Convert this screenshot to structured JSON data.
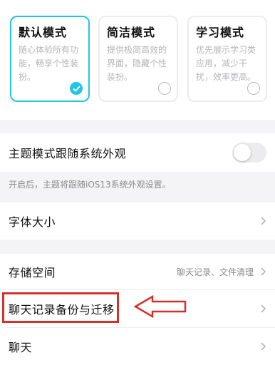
{
  "mode_cards": [
    {
      "title": "默认模式",
      "description": "随心体验所有功能，畅享个性装扮。",
      "selected": true
    },
    {
      "title": "简洁模式",
      "description": "提供极简高效的界面，隐藏个性装扮。",
      "selected": false
    },
    {
      "title": "学习模式",
      "description": "优先展示学习类应用，减少干扰，效率更高。",
      "selected": false
    }
  ],
  "follow_system": {
    "label": "主题模式跟随系统外观",
    "enabled": false,
    "hint": "开启后，主题将跟随iOS13系统外观设置。"
  },
  "font_size": {
    "label": "字体大小"
  },
  "storage": {
    "label": "存储空间",
    "value": "聊天记录、文件清理"
  },
  "chat_backup": {
    "label": "聊天记录备份与迁移"
  },
  "chat": {
    "label": "聊天"
  },
  "colors": {
    "accent": "#1fc6e6",
    "annotation": "#d6302a"
  }
}
